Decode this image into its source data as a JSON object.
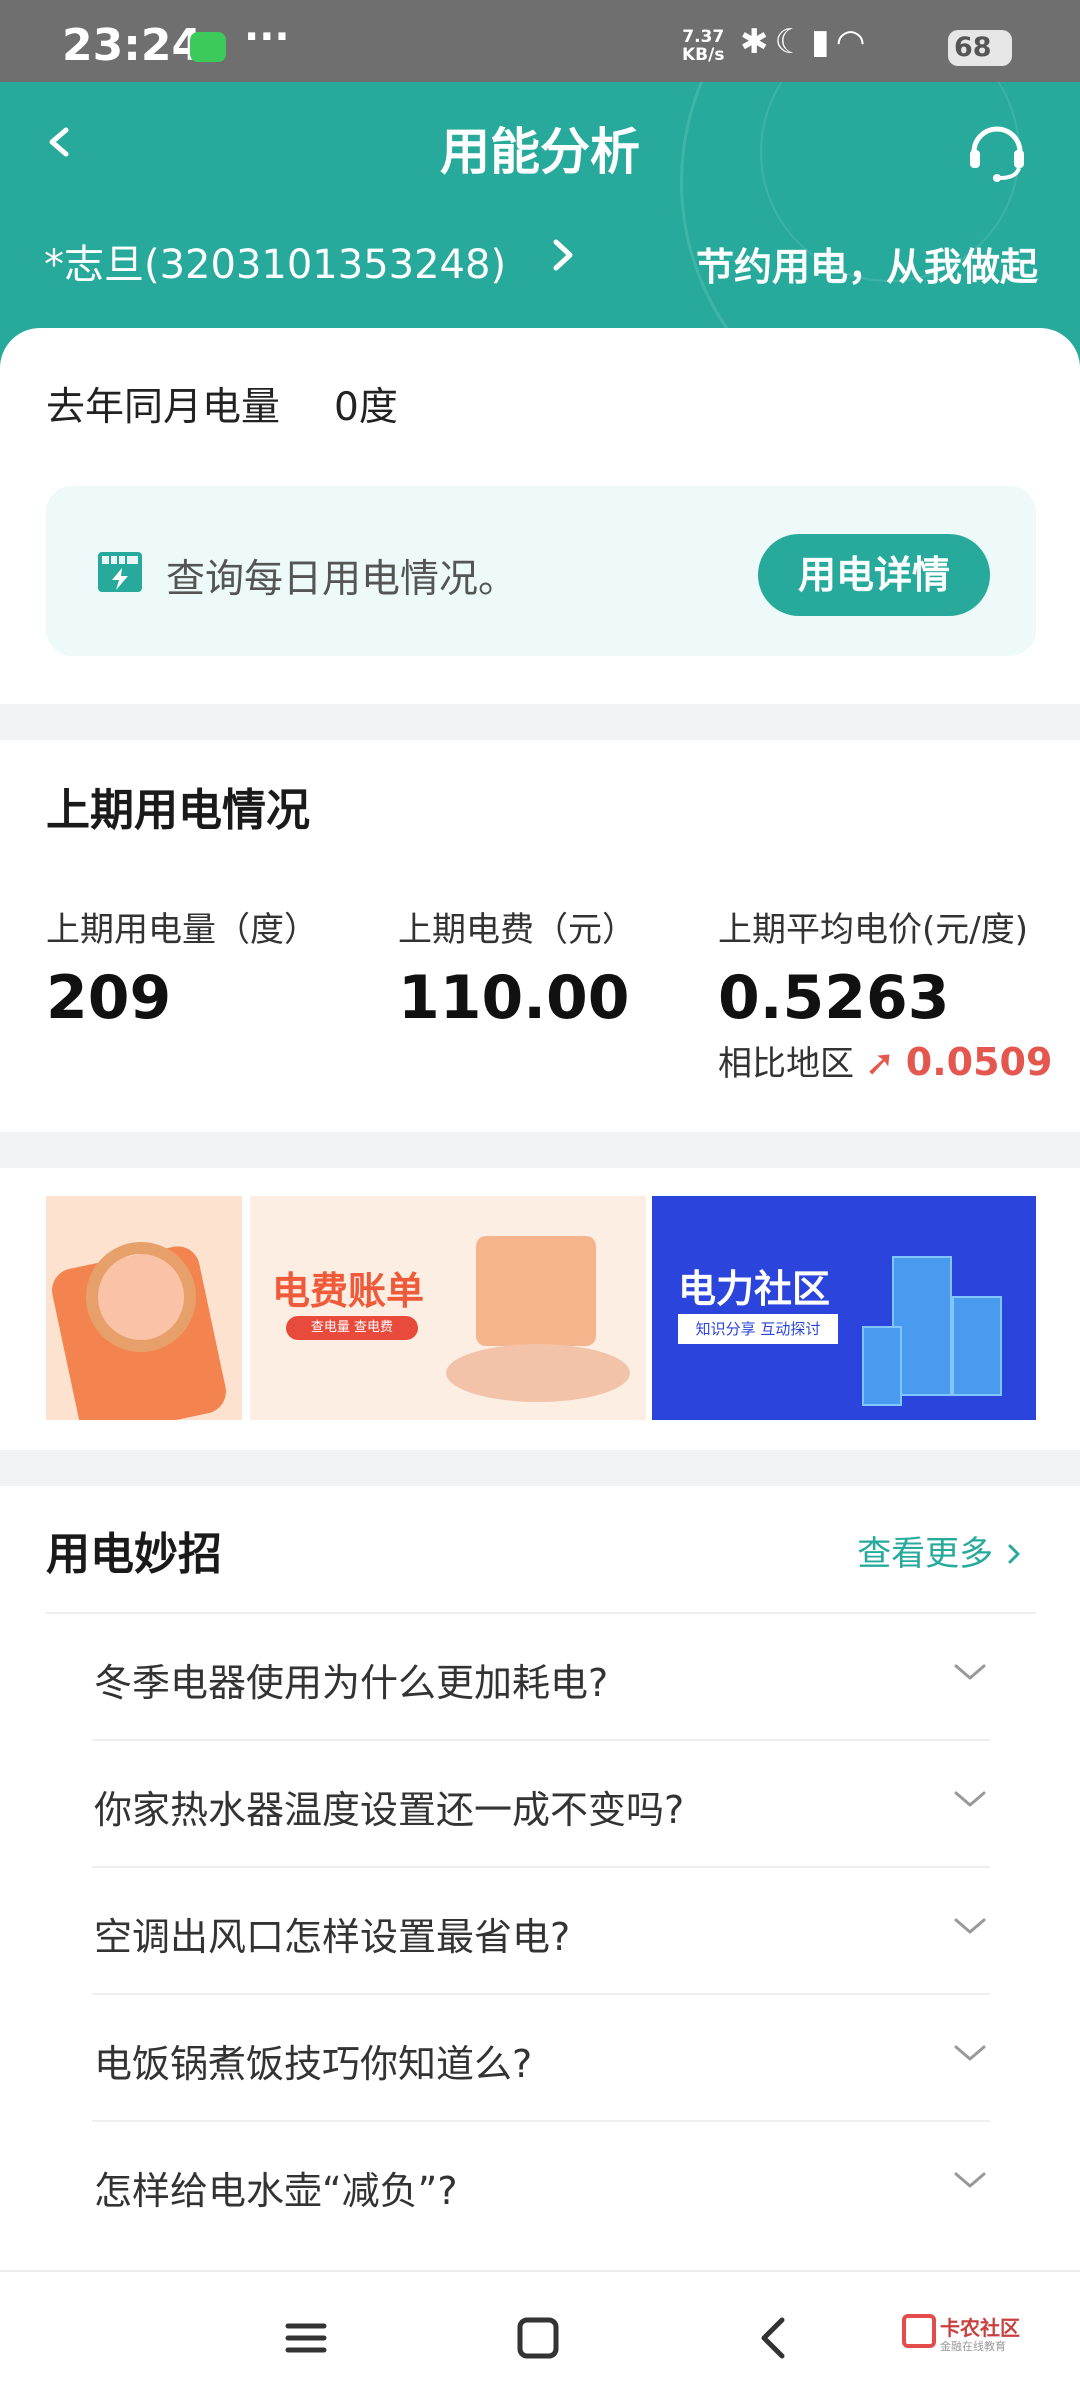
{
  "status_bar": {
    "time": "23:24",
    "extra": "···",
    "speed": "7.37\nKB/s",
    "battery": "68"
  },
  "header": {
    "title": "用能分析",
    "account": "*志旦(3203101353248)",
    "slogan": "节约用电，从我做起"
  },
  "last_year": {
    "label": "去年同月电量",
    "value": "0度"
  },
  "query": {
    "text": "查询每日用电情况。",
    "button": "用电详情"
  },
  "last_period": {
    "title": "上期用电情况",
    "usage_label": "上期用电量（度）",
    "usage_value": "209",
    "fee_label": "上期电费（元）",
    "fee_value": "110.00",
    "price_label": "上期平均电价(元/度)",
    "price_value": "0.5263",
    "compare_label": "相比地区",
    "compare_value": "0.0509"
  },
  "banners": {
    "b2_title": "电费账单",
    "b2_sub": "查电量  查电费",
    "b3_title": "电力社区",
    "b3_sub": "知识分享  互动探讨"
  },
  "tips": {
    "title": "用电妙招",
    "more": "查看更多",
    "items": [
      "冬季电器使用为什么更加耗电?",
      "你家热水器温度设置还一成不变吗?",
      "空调出风口怎样设置最省电?",
      "电饭锅煮饭技巧你知道么?",
      "怎样给电水壶“减负”?"
    ]
  },
  "watermark": {
    "name": "卡农社区",
    "sub": "金融在线教育"
  },
  "colors": {
    "primary": "#27aa9c",
    "up_red": "#e4574f"
  }
}
